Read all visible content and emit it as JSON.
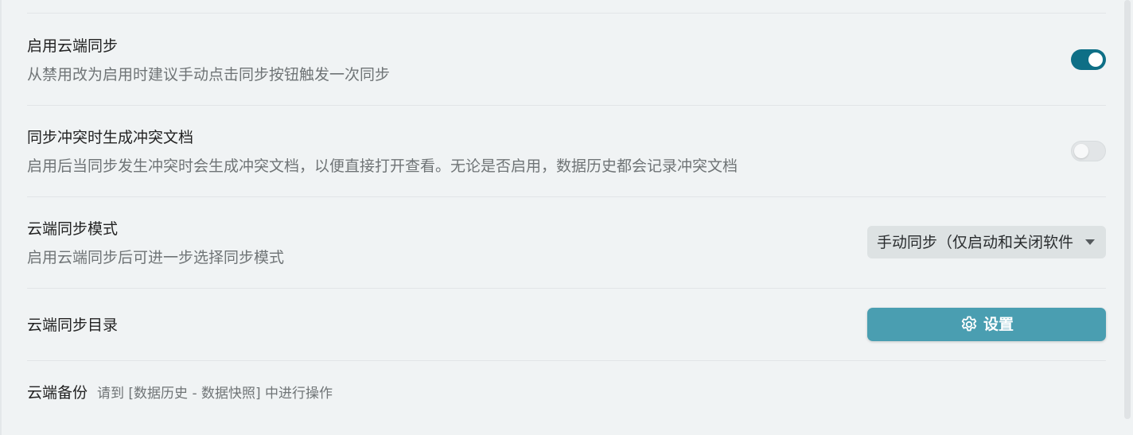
{
  "settings": {
    "cloud_sync": {
      "title": "启用云端同步",
      "description": "从禁用改为启用时建议手动点击同步按钮触发一次同步",
      "enabled": true
    },
    "conflict_doc": {
      "title": "同步冲突时生成冲突文档",
      "description": "启用后当同步发生冲突时会生成冲突文档，以便直接打开查看。无论是否启用，数据历史都会记录冲突文档",
      "enabled": false
    },
    "sync_mode": {
      "title": "云端同步模式",
      "description": "启用云端同步后可进一步选择同步模式",
      "selected": "手动同步（仅启动和关闭软件时"
    },
    "sync_dir": {
      "title": "云端同步目录",
      "button_label": "设置",
      "button_icon": "gear-icon"
    },
    "backup": {
      "title": "云端备份",
      "note": "请到 [数据历史 - 数据快照] 中进行操作"
    }
  },
  "colors": {
    "toggle_on": "#0e6f86",
    "button": "#4a9eb1",
    "background": "#f0f3f4"
  }
}
